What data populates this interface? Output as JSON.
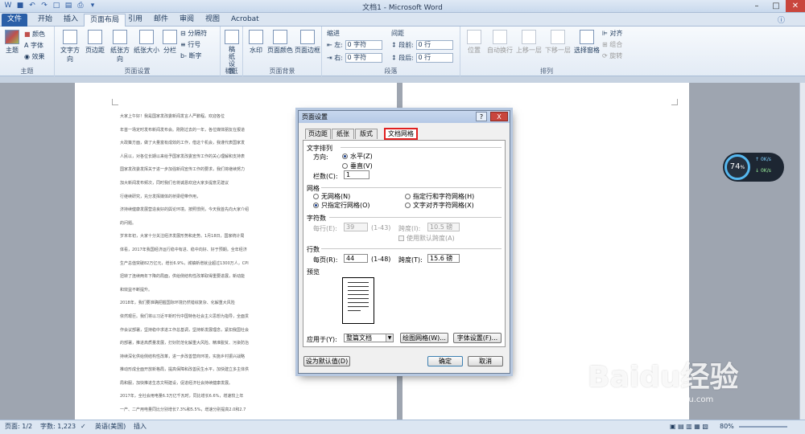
{
  "window": {
    "title": "文档1 - Microsoft Word"
  },
  "tabs": [
    "文件",
    "开始",
    "插入",
    "页面布局",
    "引用",
    "邮件",
    "审阅",
    "视图",
    "Acrobat"
  ],
  "active_tab": "页面布局",
  "ribbon": {
    "theme": {
      "items": [
        "主题",
        "颜色",
        "字体",
        "效果"
      ],
      "label": "主题"
    },
    "page_setup": {
      "buttons": [
        "文字方向",
        "页边距",
        "纸张方向",
        "纸张大小",
        "分栏"
      ],
      "small": [
        "分隔符",
        "行号",
        "断字"
      ],
      "label": "页面设置"
    },
    "manuscript": {
      "button": "稿纸设置",
      "label": "稿纸"
    },
    "page_bg": {
      "buttons": [
        "水印",
        "页面颜色",
        "页面边框"
      ],
      "label": "页面背景"
    },
    "paragraph": {
      "indent": "缩进",
      "spacing": "间距",
      "left_label": "左:",
      "right_label": "右:",
      "left_val": "0 字符",
      "right_val": "0 字符",
      "before_label": "段前:",
      "after_label": "段后:",
      "before_val": "0 行",
      "after_val": "0 行",
      "label": "段落"
    },
    "arrange": {
      "buttons": [
        "位置",
        "自动换行",
        "上移一层",
        "下移一层",
        "选择窗格"
      ],
      "small": [
        "对齐",
        "组合",
        "旋转"
      ],
      "label": "排列"
    }
  },
  "dialog": {
    "title": "页面设置",
    "help": "?",
    "close": "X",
    "tabs": [
      "页边距",
      "纸张",
      "版式",
      "文档网格"
    ],
    "active_tab": "文档网格",
    "text_direction": {
      "header": "文字排列",
      "dir_label": "方向:",
      "horizontal": "水平(Z)",
      "vertical": "垂直(V)",
      "cols_label": "栏数(C):",
      "cols_val": "1"
    },
    "grid": {
      "header": "网格",
      "none": "无网格(N)",
      "line_only": "只指定行网格(O)",
      "line_char": "指定行和字符网格(H)",
      "snap_char": "文字对齐字符网格(X)"
    },
    "chars": {
      "header": "字符数",
      "per_line_label": "每行(E):",
      "per_line_val": "39",
      "per_line_range": "(1-43)",
      "pitch_label": "跨度(I):",
      "pitch_val": "10.5 磅",
      "default_pitch": "使用默认跨度(A)"
    },
    "lines": {
      "header": "行数",
      "per_page_label": "每页(R):",
      "per_page_val": "44",
      "per_page_range": "(1-48)",
      "pitch_label": "跨度(T):",
      "pitch_val": "15.6 磅"
    },
    "preview": {
      "header": "预览"
    },
    "apply_label": "应用于(Y):",
    "apply_val": "整篇文档",
    "draw_grid": "绘图网格(W)...",
    "font_settings": "字体设置(F)...",
    "set_default": "设为默认值(D)",
    "ok": "确定",
    "cancel": "取消"
  },
  "document": {
    "paragraphs": [
      "大家上午好！我是国家发改委新闻发言人严鹏程。欢迎各位",
      "年首一场定时发布新闻发布会。刚刚过去的一年，各位媒体朋友在报道",
      "大政策方面，做了大量富有成效的工作，借这个机会，我谨代表国家发",
      "人民以，对各位长期以来给予国家发改委宣传工作的关心理解和支持表",
      "国家发改委发挥关于进一步加强新闻宣传工作的要求，我们将继续努力",
      "加大新闻发布频次，同时我们也将诚恳欢迎大家多提意见建议",
      "行继续研究，充分发挥媒体的桥梁纽带作用，",
      "济持续健康发展营造良好的舆论环境。按照惯例，今天我首先向大家介绍",
      "的问题。",
      "岁末年初，大家十分关注经济发展形势和走势。1月18日，国家统计局",
      "体看，2017年我国经济运行稳中有进、稳中向好、好于预期。全年经济",
      "生产总值突破82万亿元，增长6.9%，城镇新增就业超过1300万人，CPI",
      "扭转了连续两年下降的局面，供给侧结构性改革取得重要进展，新动能",
      "和效益不断提升。",
      "2018年，我们要准确把握国际环境仍然错综复杂、化解重大风险",
      "依然艰巨。我们将以习近平新时代中国特色社会主义思想为指导，全面贯",
      "作会议部署，坚持稳中求进工作总基调，坚持新发展理念，紧扣我国社会",
      "的部署，推进高质量发展，打好防范化解重大风险、精准脱贫、污染防治",
      "持续深化供给侧结构性改革，进一步改善营商环境，实施乡村振兴战略",
      "推动形成全面开放新格局，提高保障和改善民生水平，加快建立多主体供",
      "局和服，加快推进生态文明建设，促进经济社会持续健康发展。",
      "2017年，全社会用电量6.3万亿千瓦时，同比增长6.6%，增速较上年",
      "一产、二产用电量同比分别增长7.3%和5.5%，增速分别提高2.0和2.7",
      "同比分别增长10.7%和7.8%，增速分别回落0.8和3.1个百分点。",
      "分产业看：二产用电对全社会用电增长的贡献率为60.2%，拉动全社"
    ]
  },
  "widget": {
    "cpu": "74",
    "unit": "%",
    "up": "0K/s",
    "down": "0K/s"
  },
  "statusbar": {
    "page": "页面: 1/2",
    "words": "字数: 1,223",
    "lang": "英语(美国)",
    "mode": "插入",
    "zoom": "80%"
  },
  "watermark": {
    "brand": "Baidu经验",
    "url": "jingyan.baidu.com"
  }
}
